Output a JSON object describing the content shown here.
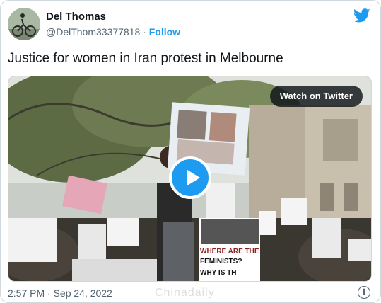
{
  "author": {
    "name": "Del Thomas",
    "handle": "@DelThom33377818",
    "separator": "·",
    "follow_label": "Follow"
  },
  "tweet": {
    "text": "Justice for women in Iran protest in Melbourne"
  },
  "media": {
    "watch_label": "Watch on Twitter",
    "sign_text_line1": "WHERE ARE THE",
    "sign_text_line2": "FEMINISTS?",
    "sign_text_line3": "WHY IS TH"
  },
  "footer": {
    "timestamp": "2:57 PM · Sep 24, 2022",
    "info_icon": "i"
  },
  "watermark": "Chinadaily",
  "colors": {
    "accent": "#1d9bf0",
    "text": "#0f1419",
    "muted": "#536471"
  }
}
